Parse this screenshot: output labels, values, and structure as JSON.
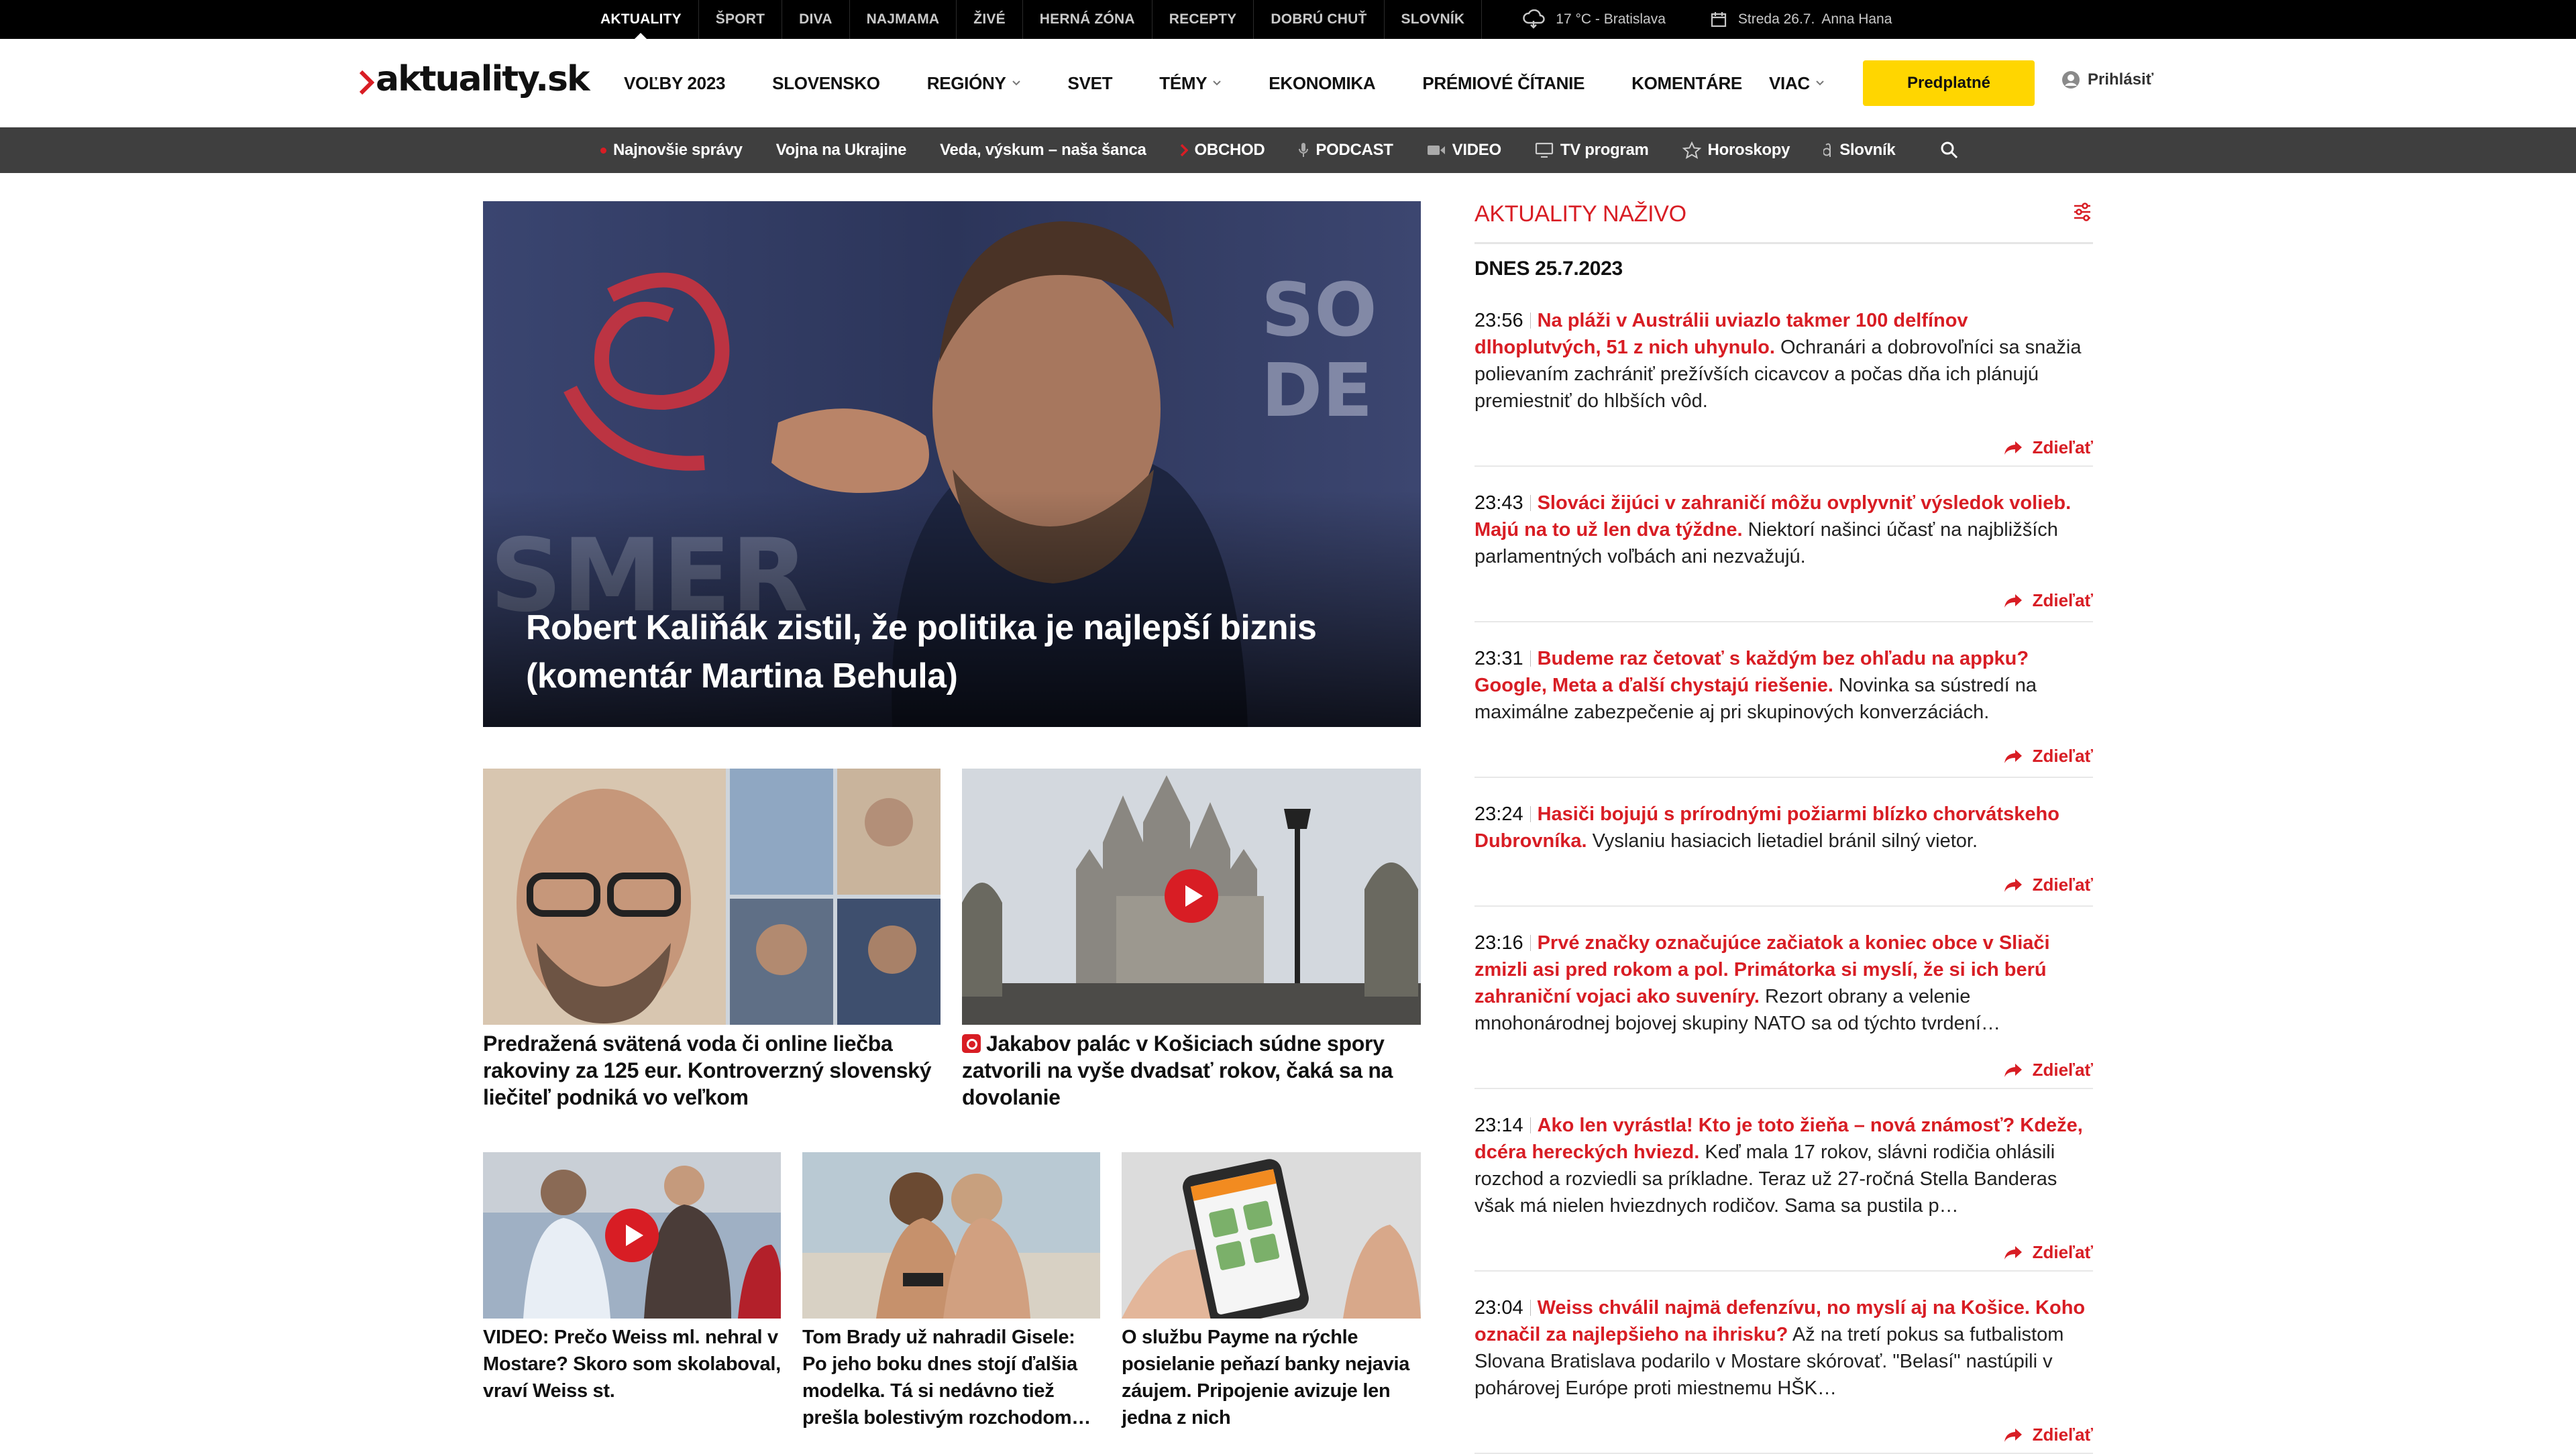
{
  "topbar": {
    "links": [
      {
        "label": "AKTUALITY",
        "active": true
      },
      {
        "label": "ŠPORT"
      },
      {
        "label": "DIVA"
      },
      {
        "label": "NAJMAMA"
      },
      {
        "label": "ŽIVÉ"
      },
      {
        "label": "HERNÁ ZÓNA"
      },
      {
        "label": "RECEPTY"
      },
      {
        "label": "DOBRÚ CHUŤ"
      },
      {
        "label": "SLOVNÍK"
      }
    ],
    "weather": "17 °C - Bratislava",
    "weather_icon": "cloud-rain-icon",
    "date": "Streda 26.7.",
    "nameday": "Anna  Hana",
    "calendar_icon": "calendar-icon"
  },
  "header": {
    "logo": "aktuality.sk",
    "nav": [
      {
        "label": "VOĽBY 2023"
      },
      {
        "label": "SLOVENSKO"
      },
      {
        "label": "REGIÓNY",
        "dropdown": true
      },
      {
        "label": "SVET"
      },
      {
        "label": "TÉMY",
        "dropdown": true
      },
      {
        "label": "EKONOMIKA"
      },
      {
        "label": "PRÉMIOVÉ ČÍTANIE"
      },
      {
        "label": "KOMENTÁRE"
      },
      {
        "label": "VIAC",
        "dropdown": true
      }
    ],
    "subscribe": "Predplatné",
    "login": "Prihlásiť"
  },
  "subbar": {
    "items": [
      {
        "label": "Najnovšie správy",
        "icon": "red-dot-icon"
      },
      {
        "label": "Vojna na Ukrajine"
      },
      {
        "label": "Veda, výskum – naša šanca"
      },
      {
        "label": "OBCHOD",
        "icon": "chevron-red-icon"
      },
      {
        "label": "PODCAST",
        "icon": "microphone-icon"
      },
      {
        "label": "VIDEO",
        "icon": "video-camera-icon"
      },
      {
        "label": "TV program",
        "icon": "tv-icon"
      },
      {
        "label": "Horoskopy",
        "icon": "star-icon"
      },
      {
        "label": "Slovník",
        "icon": "slovnik-icon"
      }
    ]
  },
  "hero": {
    "title": "Robert Kaliňák zistil, že politika je najlepší biznis (komentár Martina Behula)"
  },
  "cards_row1": [
    {
      "title": "Predražená svätená voda či online liečba rakoviny za 125 eur. Kontroverzný slovenský liečiteľ podniká vo veľkom"
    },
    {
      "title": "Jakabov palác v Košiciach súdne spory zatvorili na vyše dvadsať rokov, čaká sa na dovolanie",
      "gallery": true,
      "video": true
    }
  ],
  "cards_row2": [
    {
      "title": "VIDEO: Prečo Weiss ml. nehral v Mostare? Skoro som skolaboval, vraví Weiss st.",
      "video": true
    },
    {
      "title": "Tom Brady už nahradil Gisele: Po jeho boku dnes stojí ďalšia modelka. Tá si nedávno tiež prešla bolestivým rozchodom…"
    },
    {
      "title": "O službu Payme na rýchle posielanie peňazí banky nejavia záujem. Pripojenie avizuje len jedna z nich"
    }
  ],
  "live": {
    "title": "AKTUALITY NAŽIVO",
    "date": "DNES 25.7.2023",
    "share_label": "Zdieľať",
    "entries": [
      {
        "time": "23:56",
        "headline": "Na pláži v Austrálii uviazlo takmer 100 delfínov dlhoplutvých, 51 z nich uhynulo.",
        "text": "Ochranári a dobrovoľníci sa snažia polievaním zachrániť prežívších cicavcov a počas dňa ich plánujú premiestniť do hlbších vôd."
      },
      {
        "time": "23:43",
        "headline": "Slováci žijúci v zahraničí môžu ovplyvniť výsledok volieb. Majú na to už len dva týždne.",
        "text": "Niektorí našinci účasť na najbližších parlamentných voľbách ani nezvažujú."
      },
      {
        "time": "23:31",
        "headline": "Budeme raz četovať s každým bez ohľadu na appku? Google, Meta a ďalší chystajú riešenie.",
        "text": "Novinka sa sústredí na maximálne zabezpečenie aj pri skupinových konverzáciách."
      },
      {
        "time": "23:24",
        "headline": "Hasiči bojujú s prírodnými požiarmi blízko chorvátskeho Dubrovníka.",
        "text": "Vyslaniu hasiacich lietadiel bránil silný vietor."
      },
      {
        "time": "23:16",
        "headline": "Prvé značky označujúce začiatok a koniec obce v Sliači zmizli asi pred rokom a pol. Primátorka si myslí, že si ich berú zahraniční vojaci ako suveníry.",
        "text": "Rezort obrany a velenie mnohonárodnej bojovej skupiny NATO sa od týchto tvrdení…"
      },
      {
        "time": "23:14",
        "headline": "Ako len vyrástla! Kto je toto žieňa – nová známosť? Kdeže, dcéra hereckých hviezd.",
        "text": "Keď mala 17 rokov, slávni rodičia ohlásili rozchod a rozviedli sa príkladne. Teraz už 27-ročná Stella Banderas však má nielen hviezdnych rodičov. Sama sa pustila p…"
      },
      {
        "time": "23:04",
        "headline": "Weiss chválil najmä defenzívu, no myslí aj na Košice. Koho označil za najlepšieho na ihrisku?",
        "text": "Až na tretí pokus sa futbalistom Slovana Bratislava podarilo v Mostare skórovať. \"Belasí\" nastúpili v pohárovej Európe proti miestnemu HŠK…"
      }
    ]
  },
  "colors": {
    "accent_red": "#d81d24",
    "subscribe_yellow": "#ffd600",
    "topbar_bg": "#000000",
    "subbar_bg": "#3f3f3f"
  }
}
